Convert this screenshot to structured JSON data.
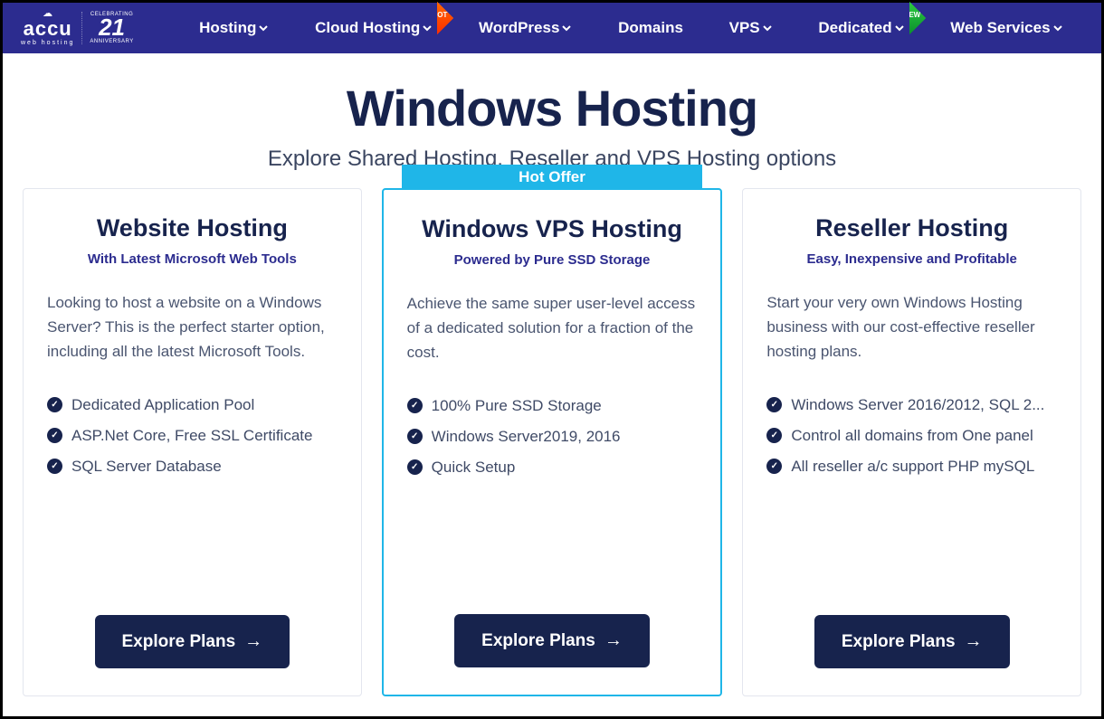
{
  "logo": {
    "main": "accu",
    "sub": "web hosting",
    "celebrating": "CELEBRATING",
    "years": "21",
    "anniversary": "ANNIVERSARY"
  },
  "nav": [
    {
      "label": "Hosting",
      "dropdown": true,
      "badge": null
    },
    {
      "label": "Cloud Hosting",
      "dropdown": true,
      "badge": "HOT"
    },
    {
      "label": "WordPress",
      "dropdown": true,
      "badge": null
    },
    {
      "label": "Domains",
      "dropdown": false,
      "badge": null
    },
    {
      "label": "VPS",
      "dropdown": true,
      "badge": null
    },
    {
      "label": "Dedicated",
      "dropdown": true,
      "badge": "NEW"
    },
    {
      "label": "Web Services",
      "dropdown": true,
      "badge": null
    }
  ],
  "hero": {
    "title": "Windows Hosting",
    "subtitle": "Explore Shared Hosting, Reseller and VPS Hosting options"
  },
  "hot_offer_label": "Hot Offer",
  "explore_label": "Explore Plans",
  "cards": [
    {
      "title": "Website Hosting",
      "tagline": "With Latest Microsoft Web Tools",
      "description": "Looking to host a website on a Windows Server? This is the perfect starter option, including all the latest Microsoft Tools.",
      "features": [
        "Dedicated Application Pool",
        "ASP.Net Core, Free SSL Certificate",
        "SQL Server Database"
      ],
      "featured": false
    },
    {
      "title": "Windows VPS Hosting",
      "tagline": "Powered by Pure SSD Storage",
      "description": "Achieve the same super user-level access of a dedicated solution for a fraction of the cost.",
      "features": [
        "100% Pure SSD Storage",
        "Windows Server2019, 2016",
        "Quick Setup"
      ],
      "featured": true
    },
    {
      "title": "Reseller Hosting",
      "tagline": "Easy, Inexpensive and Profitable",
      "description": "Start your very own Windows Hosting business with our cost-effective reseller hosting plans.",
      "features": [
        "Windows Server 2016/2012, SQL 2...",
        "Control all domains from One panel",
        "All reseller a/c support PHP mySQL"
      ],
      "featured": false
    }
  ]
}
